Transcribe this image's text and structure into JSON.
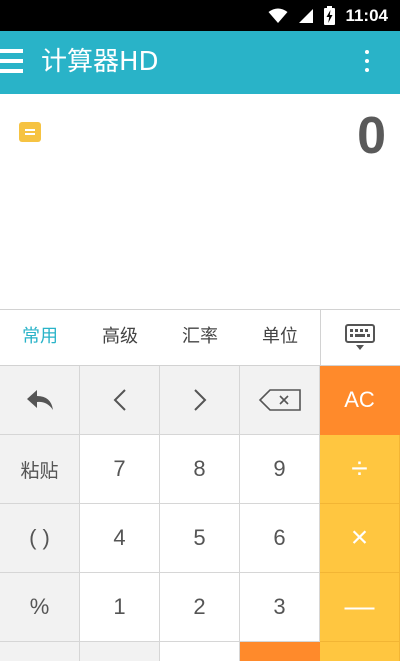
{
  "status_bar": {
    "time": "11:04",
    "icons": [
      "wifi-icon",
      "signal-icon",
      "battery-charging-icon"
    ]
  },
  "app_bar": {
    "title": "计算器HD",
    "icons": [
      "menu-icon",
      "more-vert-icon"
    ],
    "color": "#29b3c8"
  },
  "display": {
    "value": "0",
    "icon": "history-list-icon"
  },
  "tabs": {
    "items": [
      "常用",
      "高级",
      "汇率",
      "单位"
    ],
    "active_index": 0,
    "keyboard_icon": "keyboard-icon"
  },
  "keypad": {
    "row1": {
      "undo": "undo-arrow-icon",
      "left": "chevron-left-icon",
      "right": "chevron-right-icon",
      "backspace": "backspace-icon",
      "clear": "AC"
    },
    "row2": [
      "粘贴",
      "7",
      "8",
      "9",
      "÷"
    ],
    "row3": [
      "( )",
      "4",
      "5",
      "6",
      "×"
    ],
    "row4": [
      "%",
      "1",
      "2",
      "3",
      "—"
    ]
  },
  "colors": {
    "accent": "#29b3c8",
    "clear_key": "#ff8a2b",
    "operator_key": "#ffc640"
  }
}
